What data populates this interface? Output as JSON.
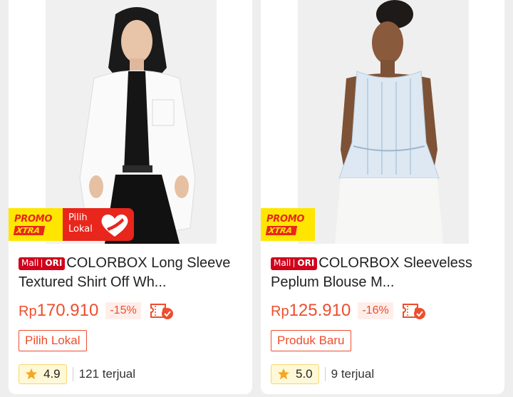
{
  "products": [
    {
      "promo_line1": "PROMO",
      "promo_line2": "XTRA",
      "lokal_badge": "Pilih Lokal",
      "mall_label": "Mall",
      "ori_label": "ORI",
      "title": "COLORBOX Long Sleeve Textured Shirt Off Wh...",
      "currency": "Rp",
      "price": "170.910",
      "discount": "-15%",
      "tag": "Pilih Lokal",
      "rating": "4.9",
      "sold": "121 terjual"
    },
    {
      "promo_line1": "PROMO",
      "promo_line2": "XTRA",
      "mall_label": "Mall",
      "ori_label": "ORI",
      "title": "COLORBOX Sleeveless Peplum Blouse M...",
      "currency": "Rp",
      "price": "125.910",
      "discount": "-16%",
      "tag": "Produk Baru",
      "rating": "5.0",
      "sold": "9 terjual"
    }
  ],
  "colors": {
    "accent": "#ee4d2d",
    "mall_red": "#d0011b",
    "promo_yellow": "#ffe600",
    "rating_bg": "#fff8d6"
  },
  "icons": [
    "heart-icon",
    "voucher-icon",
    "star-icon"
  ]
}
